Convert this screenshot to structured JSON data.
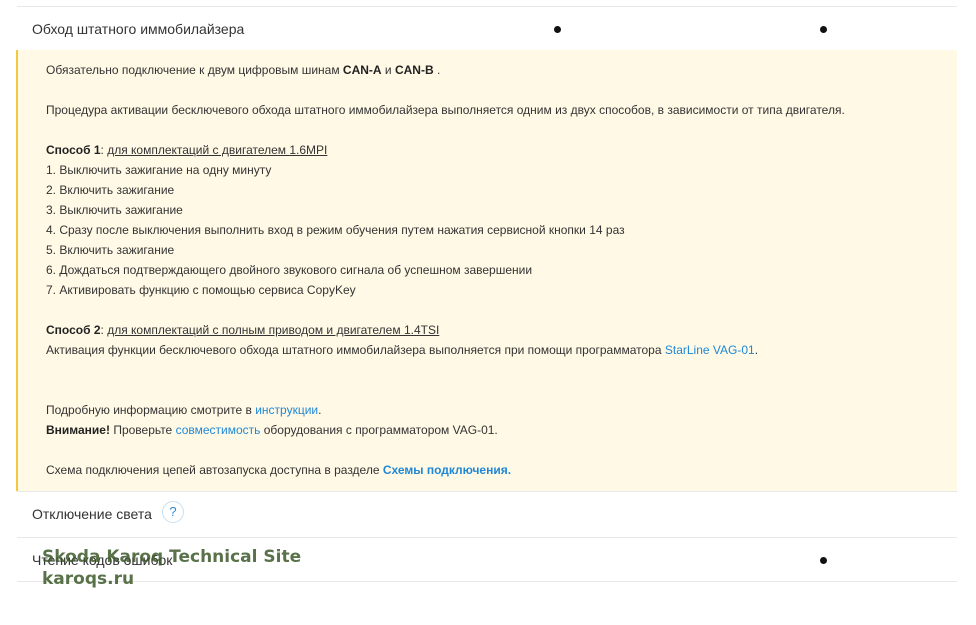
{
  "rows": {
    "immobilizer": {
      "label": "Обход штатного иммобилайзера"
    },
    "lights_off": {
      "label": "Отключение света",
      "help_icon": "?"
    },
    "error_codes": {
      "label": "Чтение кодов ошибок"
    }
  },
  "info": {
    "line1_pre": "Обязательно подключение к двум цифровым шинам ",
    "can_a": "CAN-A",
    "line1_and": " и ",
    "can_b": "CAN-B",
    "line1_post": " .",
    "line2": "Процедура активации бесключевого обхода штатного иммобилайзера выполняется одним из двух способов, в зависимости от типа двигателя.",
    "method1_title": "Способ 1",
    "method1_sep": ": ",
    "method1_desc": "для комплектаций с двигателем 1.6MPI",
    "steps": [
      "1. Выключить зажигание на одну минуту",
      "2. Включить зажигание",
      "3. Выключить зажигание",
      "4. Сразу после выключения выполнить вход в режим обучения путем нажатия сервисной кнопки 14 раз",
      "5. Включить зажигание",
      "6. Дождаться подтверждающего двойного звукового сигнала об успешном завершении",
      "7. Активировать функцию с помощью сервиса CopyKey"
    ],
    "method2_title": "Способ 2",
    "method2_sep": ": ",
    "method2_desc": "для комплектаций с полным приводом и двигателем 1.4TSI",
    "method2_text": "Активация функции бесключевого обхода штатного иммобилайзера выполняется при помощи программатора ",
    "method2_link": "StarLine VAG-01",
    "method2_end": ".",
    "details_pre": "Подробную информацию смотрите в ",
    "details_link": "инструкции",
    "details_end": ".",
    "warning_title": "Внимание!",
    "warning_pre": " Проверьте ",
    "warning_link": "совместимость",
    "warning_post": " оборудования с программатором VAG-01.",
    "scheme_pre": "Схема подключения цепей автозапуска доступна в разделе ",
    "scheme_link": "Схемы подключения."
  },
  "watermark": {
    "line1": "Skoda Karoq Technical Site",
    "line2": "karoqs.ru"
  }
}
